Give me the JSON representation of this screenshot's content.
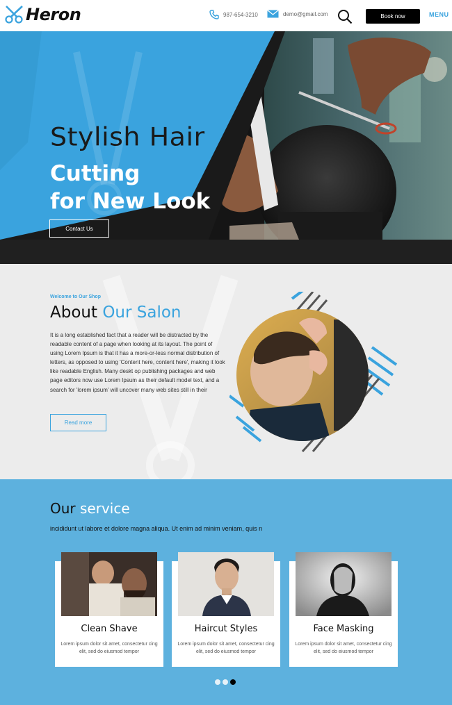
{
  "header": {
    "logo_text": "Heron",
    "phone": "987-654-3210",
    "email": "demo@gmail.com",
    "book_label": "Book now",
    "menu_label": "MENU"
  },
  "hero": {
    "title_line1": "Stylish Hair",
    "title_line2": "Cutting",
    "title_line3": "for New Look",
    "contact_label": "Contact Us"
  },
  "about": {
    "kicker": "Welcome to Our Shop",
    "title_part1": "About",
    "title_part2": "Our Salon",
    "body": "It is a long established fact that a reader will be distracted by the readable content of a page when looking at its layout. The point of using Lorem Ipsum is that it has a more-or-less normal distribution of letters, as opposed to using 'Content here, content here', making it look like readable English. Many deskt op publishing packages and web page editors now use Lorem Ipsum as their default model text, and a search for 'lorem ipsum' will uncover many web sites still in their",
    "read_more_label": "Read more"
  },
  "services": {
    "title_part1": "Our",
    "title_part2": "service",
    "subtitle": "incididunt ut labore et dolore magna aliqua. Ut enim ad minim veniam, quis n",
    "cards": [
      {
        "title": "Clean Shave",
        "text": "Lorem ipsum dolor sit amet, consectetur cing elit, sed do eiusmod tempor"
      },
      {
        "title": "Haircut Styles",
        "text": "Lorem ipsum dolor sit amet, consectetur cing elit, sed do eiusmod tempor"
      },
      {
        "title": "Face Masking",
        "text": "Lorem ipsum dolor sit amet, consectetur cing elit, sed do eiusmod tempor"
      }
    ],
    "active_dot": 3
  },
  "colors": {
    "accent": "#3aa3de",
    "services_bg": "#5db1de",
    "about_bg": "#ececec"
  }
}
